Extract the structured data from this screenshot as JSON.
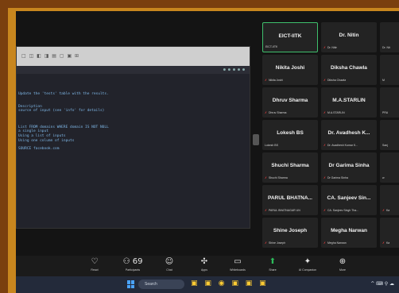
{
  "shared_screen": {
    "toolbar_icons": "□ ◫ ◧ ◨ ▤ ▢ ▣ ⊞",
    "terminal_dots": "● ● ● ● ●",
    "terminal_lines": [
      "",
      "",
      "",
      "Update the 'tests' table with the results.",
      "",
      "",
      "Description",
      "source of input (see 'info' for details)",
      "",
      "",
      "",
      "List FROM domains WHERE domain IS NOT NULL",
      "a single input",
      "Using a list of inputs",
      "Using one column of inputs",
      "",
      "SOURCE facebook.com"
    ]
  },
  "participants": [
    {
      "name": "EICT-IITK",
      "sub": "EICT-IITK",
      "active": true,
      "mic": false
    },
    {
      "name": "Dr. Nitin",
      "sub": "Dr. Nitin",
      "active": false,
      "mic": true
    },
    {
      "name": "Dr.",
      "sub": "Dr. Nit",
      "active": false,
      "mic": false
    },
    {
      "name": "Nikita Joshi",
      "sub": "Nikita Joshi",
      "active": false,
      "mic": true
    },
    {
      "name": "Diksha Chawla",
      "sub": "Diksha Chawla",
      "active": false,
      "mic": true
    },
    {
      "name": "M",
      "sub": "M",
      "active": false,
      "mic": false
    },
    {
      "name": "Dhruv Sharma",
      "sub": "Dhruv Sharma",
      "active": false,
      "mic": true
    },
    {
      "name": "M.A.STARLIN",
      "sub": "M.A.STARLIN",
      "active": false,
      "mic": true
    },
    {
      "name": "PRA",
      "sub": "PRA",
      "active": false,
      "mic": false
    },
    {
      "name": "Lokesh BS",
      "sub": "Lokesh BS",
      "active": false,
      "mic": false
    },
    {
      "name": "Dr. Avadhesh K...",
      "sub": "Dr. Avadhesh Kumar K...",
      "active": false,
      "mic": true
    },
    {
      "name": "Sanj",
      "sub": "Sanj",
      "active": false,
      "mic": false
    },
    {
      "name": "Shuchi Sharma",
      "sub": "Shuchi Sharma",
      "active": false,
      "mic": true
    },
    {
      "name": "Dr Garima Sinha",
      "sub": "Dr Garima Sinha",
      "active": false,
      "mic": true
    },
    {
      "name": "w",
      "sub": "w",
      "active": false,
      "mic": false
    },
    {
      "name": "PARUL BHATNA...",
      "sub": "PARUL BHATNAGAR UN",
      "active": false,
      "mic": true
    },
    {
      "name": "CA. Sanjeev Sin...",
      "sub": "CA. Sanjeev Singh Tha...",
      "active": false,
      "mic": true
    },
    {
      "name": "",
      "sub": "Ka",
      "active": false,
      "mic": true
    },
    {
      "name": "Shine Joseph",
      "sub": "Shine Joseph",
      "active": false,
      "mic": true
    },
    {
      "name": "Megha Narwan",
      "sub": "Megha Narwan",
      "active": false,
      "mic": true
    },
    {
      "name": "Ka",
      "sub": "Ka",
      "active": false,
      "mic": true
    }
  ],
  "toolbar": [
    {
      "icon": "♡",
      "label": "React"
    },
    {
      "icon": "⚇",
      "label": "Participants",
      "badge": "69"
    },
    {
      "icon": "☺",
      "label": "Chat"
    },
    {
      "icon": "✣",
      "label": "Apps"
    },
    {
      "icon": "▭",
      "label": "Whiteboards"
    },
    {
      "icon": "⬆",
      "label": "Share"
    },
    {
      "icon": "✦",
      "label": "AI Companion"
    },
    {
      "icon": "⊕",
      "label": "More"
    }
  ],
  "taskbar": {
    "search_placeholder": "Search",
    "app_icons": "▣ ▣ ◉ ▣ ▣ ▣",
    "tray": "^ ⌨ ⚲ ☁"
  },
  "colors": {
    "frame": "#c8861e",
    "border": "#7a3f0e",
    "active": "#3fbf6c",
    "mic": "#e23b3b"
  }
}
